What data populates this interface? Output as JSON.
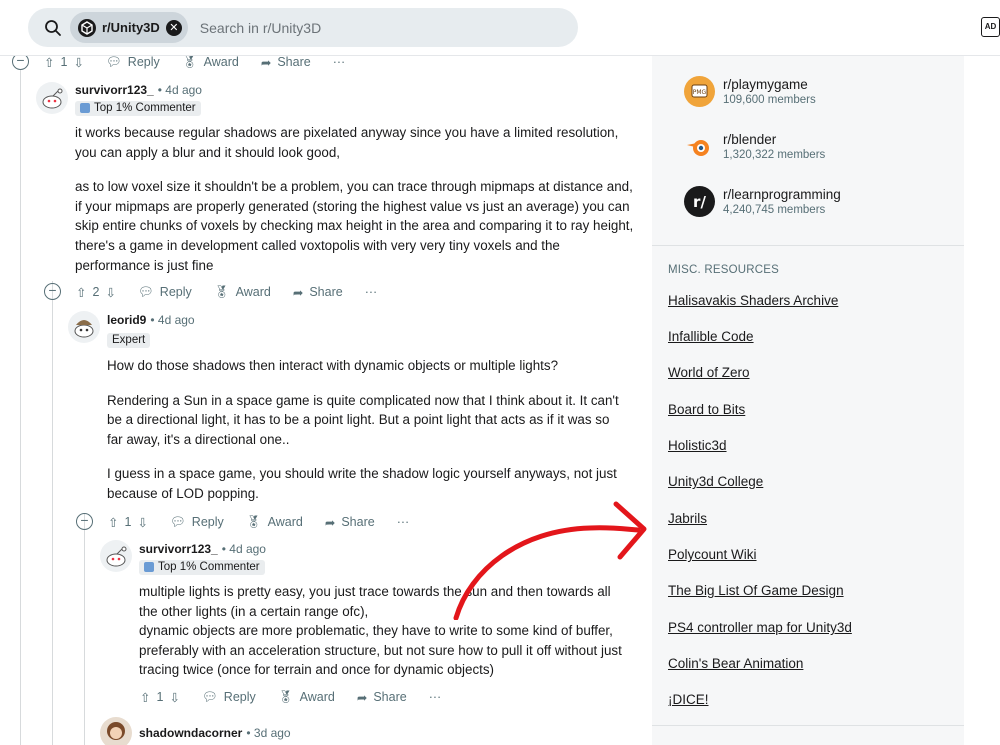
{
  "search": {
    "subreddit_chip": "r/Unity3D",
    "placeholder": "Search in r/Unity3D"
  },
  "ad_icon": "AD",
  "action_labels": {
    "reply": "Reply",
    "award": "Award",
    "share": "Share",
    "more": "···"
  },
  "comments": [
    {
      "votes": "1"
    },
    {
      "author": "survivorr123_",
      "time": "4d ago",
      "flair": "Top 1% Commenter",
      "votes": "2",
      "paragraphs": [
        "it works because regular shadows are pixelated anyway since you have a limited resolution, you can apply a blur and it should look good,",
        "as to low voxel size it shouldn't be a problem, you can trace through mipmaps at distance and, if your mipmaps are properly generated (storing the highest value vs just an average) you can skip entire chunks of voxels by checking max height in the area and comparing it to ray height, there's a game in development called voxtopolis with very very tiny voxels and the performance is just fine"
      ]
    },
    {
      "author": "leorid9",
      "time": "4d ago",
      "flair": "Expert",
      "votes": "1",
      "paragraphs": [
        "How do those shadows then interact with dynamic objects or multiple lights?",
        "Rendering a Sun in a space game is quite complicated now that I think about it. It can't be a directional light, it has to be a point light. But a point light that acts as if it was so far away, it's a directional one..",
        "I guess in a space game, you should write the shadow logic yourself anyways, not just because of LOD popping."
      ]
    },
    {
      "author": "survivorr123_",
      "time": "4d ago",
      "flair": "Top 1% Commenter",
      "votes": "1",
      "paragraphs": [
        "multiple lights is pretty easy, you just trace towards the sun and then towards all the other lights (in a certain range ofc),\ndynamic objects are more problematic, they have to write to some kind of buffer, preferably with an acceleration structure, but not sure how to pull it off without just tracing twice (once for terrain and once for dynamic objects)"
      ]
    },
    {
      "author": "shadowndacorner",
      "time": "3d ago"
    }
  ],
  "sidebar": {
    "communities": [
      {
        "name": "r/playmygame",
        "members": "109,600 members",
        "color": "#f0a43a"
      },
      {
        "name": "r/blender",
        "members": "1,320,322 members",
        "color": "#f58220"
      },
      {
        "name": "r/learnprogramming",
        "members": "4,240,745 members",
        "color": "#1a1a1b"
      }
    ],
    "misc_title": "MISC. RESOURCES",
    "links": [
      "Halisavakis Shaders Archive",
      "Infallible Code",
      "World of Zero",
      "Board to Bits",
      "Holistic3d",
      "Unity3d College",
      "Jabrils",
      "Polycount Wiki",
      "The Big List Of Game Design",
      "PS4 controller map for Unity3d",
      "Colin's Bear Animation",
      "¡DICE!"
    ]
  },
  "colors": {
    "annotation_arrow": "#e3161b",
    "flair_badge": "#6a9bd4"
  }
}
